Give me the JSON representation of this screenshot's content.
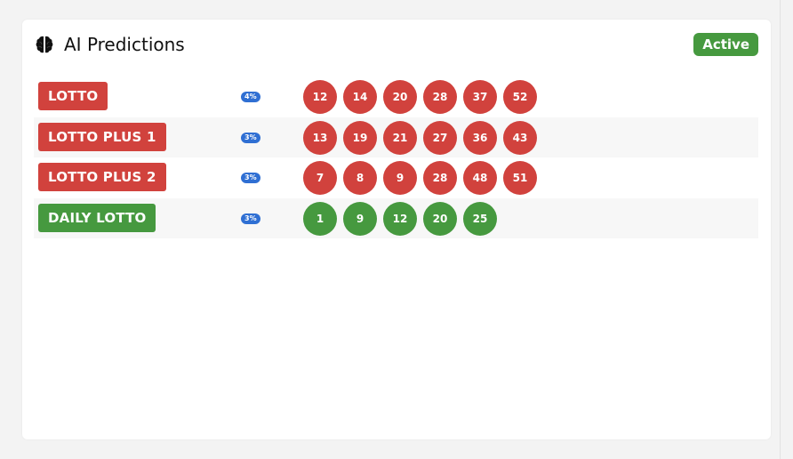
{
  "header": {
    "title": "AI Predictions",
    "icon": "brain-icon",
    "status": "Active"
  },
  "colors": {
    "red": "#d1423d",
    "green": "#46993f",
    "blue": "#2f6fd3"
  },
  "rows": [
    {
      "game": "LOTTO",
      "color": "red",
      "percent": "4%",
      "numbers": [
        "12",
        "14",
        "20",
        "28",
        "37",
        "52"
      ]
    },
    {
      "game": "LOTTO PLUS 1",
      "color": "red",
      "percent": "3%",
      "numbers": [
        "13",
        "19",
        "21",
        "27",
        "36",
        "43"
      ]
    },
    {
      "game": "LOTTO PLUS 2",
      "color": "red",
      "percent": "3%",
      "numbers": [
        "7",
        "8",
        "9",
        "28",
        "48",
        "51"
      ]
    },
    {
      "game": "DAILY LOTTO",
      "color": "green",
      "percent": "3%",
      "numbers": [
        "1",
        "9",
        "12",
        "20",
        "25"
      ]
    }
  ]
}
